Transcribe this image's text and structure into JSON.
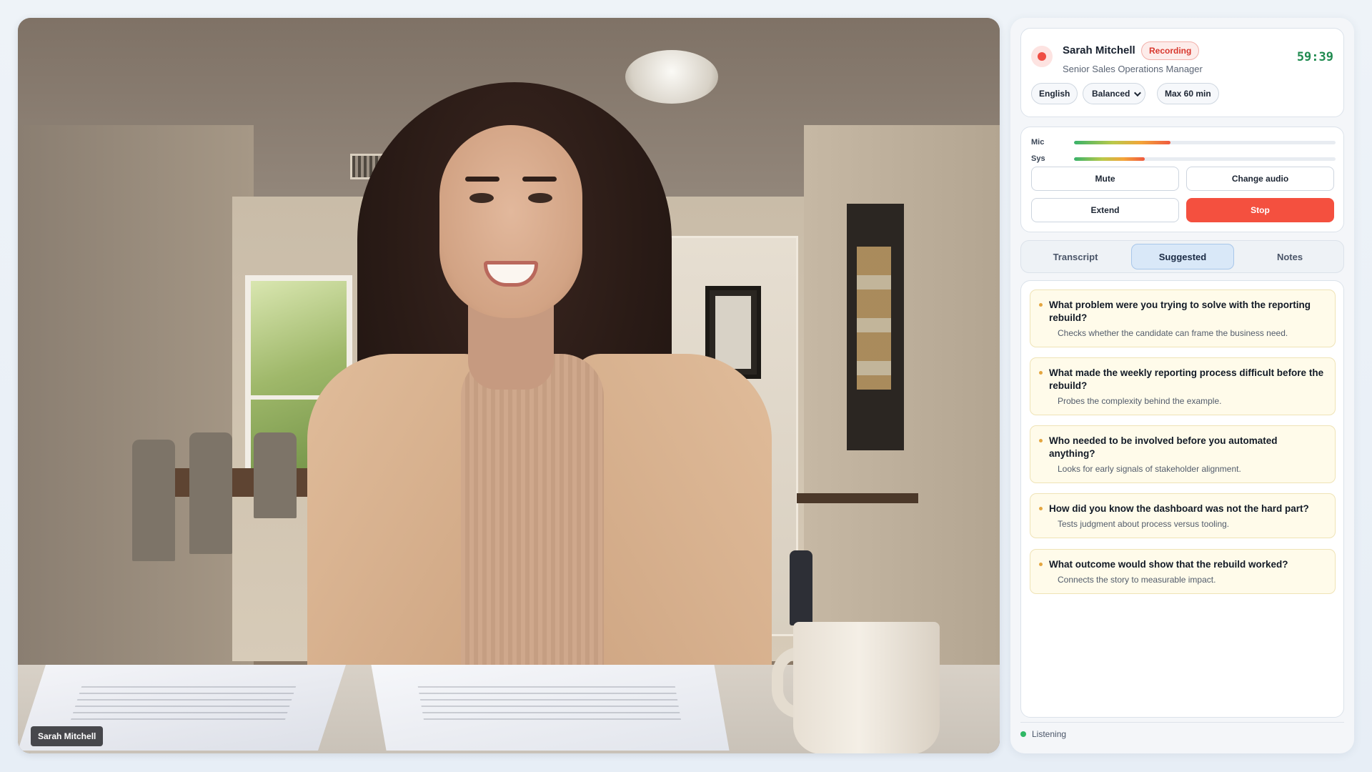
{
  "video": {
    "participant_label": "Sarah Mitchell"
  },
  "header": {
    "candidate_name": "Sarah Mitchell",
    "recording_badge": "Recording",
    "candidate_role": "Senior Sales Operations Manager",
    "timer": "59:39",
    "chips": {
      "language": "English",
      "mode": "Balanced",
      "max_duration": "Max 60 min"
    }
  },
  "audio": {
    "mic_label": "Mic",
    "sys_label": "Sys",
    "mic_level": 0.37,
    "sys_level": 0.27,
    "mute_label": "Mute",
    "change_audio_label": "Change audio",
    "extend_label": "Extend",
    "stop_label": "Stop"
  },
  "tabs": [
    {
      "label": "Transcript",
      "active": false
    },
    {
      "label": "Suggested",
      "active": true
    },
    {
      "label": "Notes",
      "active": false
    }
  ],
  "suggestions": [
    {
      "question": "What problem were you trying to solve with the reporting rebuild?",
      "hint": "Checks whether the candidate can frame the business need."
    },
    {
      "question": "What made the weekly reporting process difficult before the rebuild?",
      "hint": "Probes the complexity behind the example."
    },
    {
      "question": "Who needed to be involved before you automated anything?",
      "hint": "Looks for early signals of stakeholder alignment."
    },
    {
      "question": "How did you know the dashboard was not the hard part?",
      "hint": "Tests judgment about process versus tooling."
    },
    {
      "question": "What outcome would show that the rebuild worked?",
      "hint": "Connects the story to measurable impact."
    }
  ],
  "status": {
    "text": "Listening"
  },
  "colors": {
    "recording_red": "#ef4d43",
    "stop_button": "#f4503f",
    "timer_green": "#1f8a4f",
    "active_tab": "#d9e8f8",
    "suggestion_bg": "#fffbea",
    "status_green": "#2fb866"
  }
}
